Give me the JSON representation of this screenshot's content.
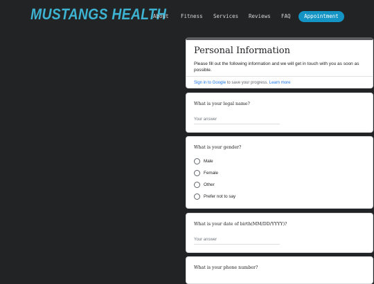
{
  "brand": {
    "name": "MUSTANGS HEALTH",
    "color": "#3db3d1"
  },
  "nav": {
    "items": [
      "About",
      "Fitness",
      "Services",
      "Reviews",
      "FAQ"
    ],
    "cta": "Appointment"
  },
  "form": {
    "title": "Personal Information",
    "description": "Please fill out the following information and we will get in touch with you as soon as possible.",
    "signin_link": "Sign in to Google",
    "signin_text": " to save your progress. ",
    "learn_more": "Learn more",
    "questions": {
      "name": {
        "label": "What is your legal name?",
        "placeholder": "Your answer"
      },
      "gender": {
        "label": "What is your gender?",
        "options": [
          "Male",
          "Female",
          "Other",
          "Prefer not to say"
        ]
      },
      "dob": {
        "label": "What is your date of birth(MM/DD/YYYY)?",
        "placeholder": "Your answer"
      },
      "phone": {
        "label": "What is your phone number?"
      }
    }
  }
}
